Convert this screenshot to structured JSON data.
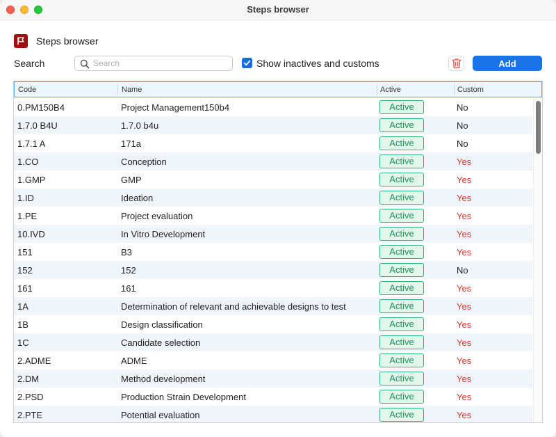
{
  "window": {
    "title": "Steps browser"
  },
  "header": {
    "title": "Steps browser",
    "logo_icon": "flag-icon",
    "logo_color": "#9b1111"
  },
  "search": {
    "label": "Search",
    "placeholder": "Search",
    "value": ""
  },
  "filter": {
    "show_inactives_label": "Show inactives and customs",
    "checked": true
  },
  "toolbar": {
    "add_label": "Add",
    "delete_icon": "trash-icon",
    "accent_color": "#1b73e8"
  },
  "table": {
    "columns": {
      "code": "Code",
      "name": "Name",
      "active": "Active",
      "custom": "Custom"
    },
    "rows": [
      {
        "code": "0.PM150B4",
        "name": "Project Management150b4",
        "active": "Active",
        "custom": "No"
      },
      {
        "code": "1.7.0 B4U",
        "name": "1.7.0 b4u",
        "active": "Active",
        "custom": "No"
      },
      {
        "code": "1.7.1 A",
        "name": "171a",
        "active": "Active",
        "custom": "No"
      },
      {
        "code": "1.CO",
        "name": "Conception",
        "active": "Active",
        "custom": "Yes"
      },
      {
        "code": "1.GMP",
        "name": "GMP",
        "active": "Active",
        "custom": "Yes"
      },
      {
        "code": "1.ID",
        "name": "Ideation",
        "active": "Active",
        "custom": "Yes"
      },
      {
        "code": "1.PE",
        "name": "Project evaluation",
        "active": "Active",
        "custom": "Yes"
      },
      {
        "code": "10.IVD",
        "name": "In Vitro Development",
        "active": "Active",
        "custom": "Yes"
      },
      {
        "code": "151",
        "name": "B3",
        "active": "Active",
        "custom": "Yes"
      },
      {
        "code": "152",
        "name": "152",
        "active": "Active",
        "custom": "No"
      },
      {
        "code": "161",
        "name": "161",
        "active": "Active",
        "custom": "Yes"
      },
      {
        "code": "1A",
        "name": "Determination of relevant and achievable designs to test",
        "active": "Active",
        "custom": "Yes"
      },
      {
        "code": "1B",
        "name": "Design classification",
        "active": "Active",
        "custom": "Yes"
      },
      {
        "code": "1C",
        "name": "Candidate selection",
        "active": "Active",
        "custom": "Yes"
      },
      {
        "code": "2.ADME",
        "name": "ADME",
        "active": "Active",
        "custom": "Yes"
      },
      {
        "code": "2.DM",
        "name": "Method development",
        "active": "Active",
        "custom": "Yes"
      },
      {
        "code": "2.PSD",
        "name": "Production Strain Development",
        "active": "Active",
        "custom": "Yes"
      },
      {
        "code": "2.PTE",
        "name": "Potential evaluation",
        "active": "Active",
        "custom": "Yes"
      }
    ]
  },
  "colors": {
    "active_border": "#2fb57a",
    "active_bg": "#e2f6ec",
    "active_text": "#17985a",
    "custom_yes": "#e0352b",
    "row_alt": "#f0f5fb"
  }
}
